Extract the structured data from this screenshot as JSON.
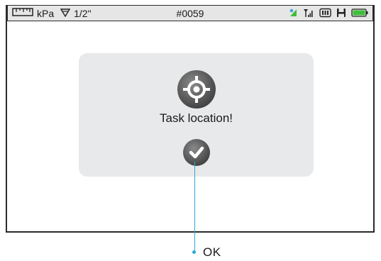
{
  "status_bar": {
    "ruler_icon": "ruler-icon",
    "unit": "kPa",
    "pipe_icon": "pipe-size-icon",
    "pipe_size": "1/2\"",
    "job_number": "#0059",
    "icons": [
      "tilt-icon",
      "signal-icon",
      "sd-card-icon",
      "save-icon",
      "battery-icon"
    ],
    "battery_color": "#3fbf3a"
  },
  "dialog": {
    "icon": "target-location-icon",
    "message": "Task location!",
    "confirm_icon": "checkmark-icon"
  },
  "callout": {
    "label": "OK",
    "color": "#2aa9d6"
  }
}
